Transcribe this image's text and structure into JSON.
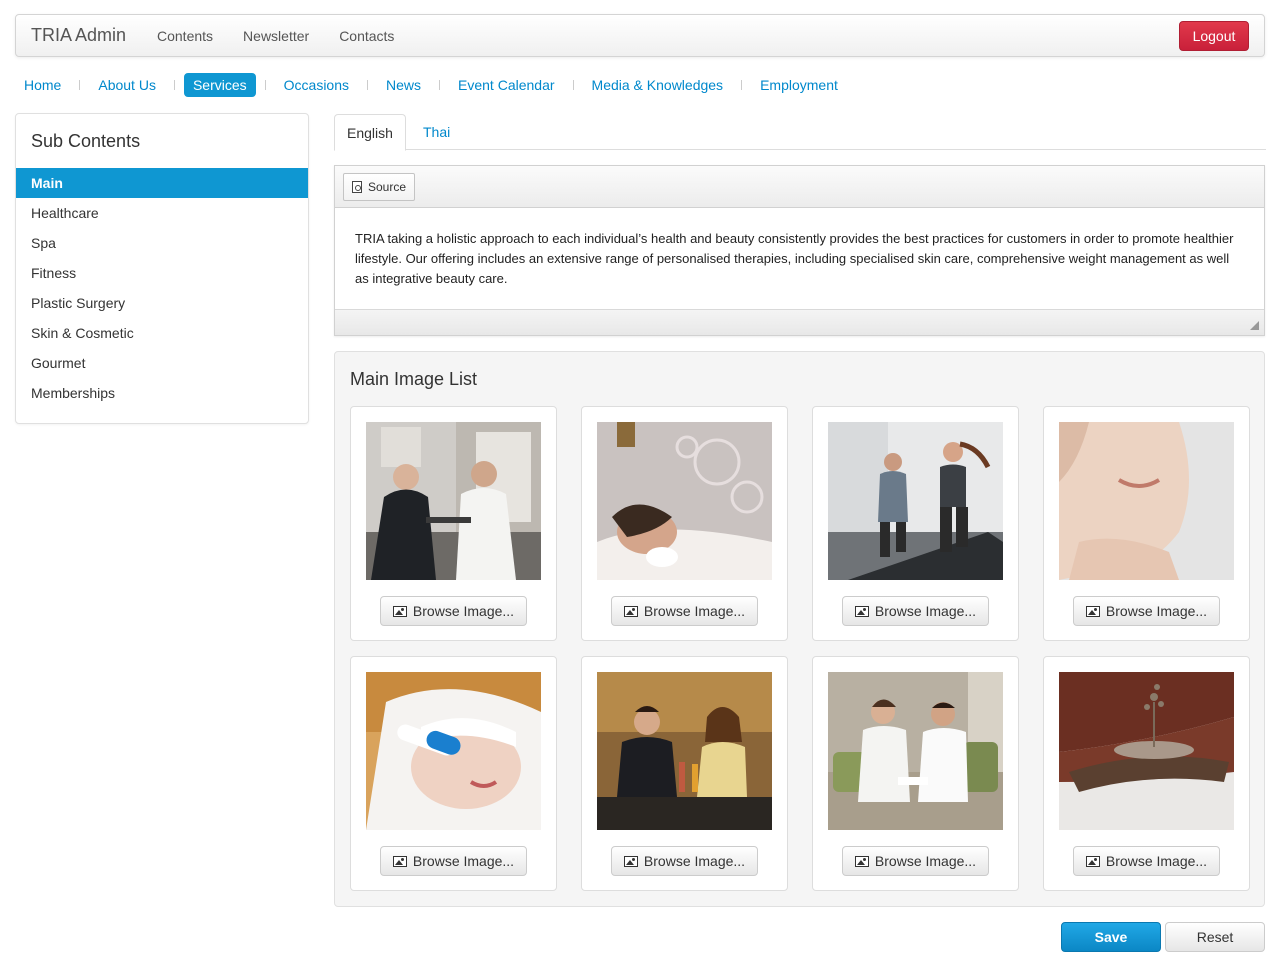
{
  "navbar": {
    "brand": "TRIA Admin",
    "items": [
      "Contents",
      "Newsletter",
      "Contacts"
    ],
    "logout_label": "Logout"
  },
  "section_nav": {
    "items": [
      "Home",
      "About Us",
      "Services",
      "Occasions",
      "News",
      "Event Calendar",
      "Media & Knowledges",
      "Employment"
    ],
    "active": "Services"
  },
  "sidebar": {
    "title": "Sub Contents",
    "items": [
      "Main",
      "Healthcare",
      "Spa",
      "Fitness",
      "Plastic Surgery",
      "Skin & Cosmetic",
      "Gourmet",
      "Memberships"
    ],
    "active": "Main"
  },
  "language_tabs": {
    "items": [
      "English",
      "Thai"
    ],
    "active": "English"
  },
  "editor": {
    "source_label": "Source",
    "content": "TRIA taking a holistic approach to each individual’s health and beauty consistently provides the best practices for customers in order to promote healthier lifestyle. Our offering includes an extensive range of personalised therapies, including specialised skin care, comprehensive weight management as well as integrative beauty care."
  },
  "image_list": {
    "title": "Main Image List",
    "browse_label": "Browse Image...",
    "images": [
      {
        "subject": "doctor-consultation"
      },
      {
        "subject": "spa-oil-treatment"
      },
      {
        "subject": "treadmill-fitness"
      },
      {
        "subject": "skin-face-closeup"
      },
      {
        "subject": "facial-device-treatment"
      },
      {
        "subject": "gourmet-dinner-couple"
      },
      {
        "subject": "couple-bathrobes-lounge"
      },
      {
        "subject": "dried-flower-stone"
      }
    ]
  },
  "actions": {
    "save_label": "Save",
    "reset_label": "Reset"
  },
  "colors": {
    "accent": "#0f97d2",
    "link": "#0088cc",
    "danger": "#d42a42"
  }
}
